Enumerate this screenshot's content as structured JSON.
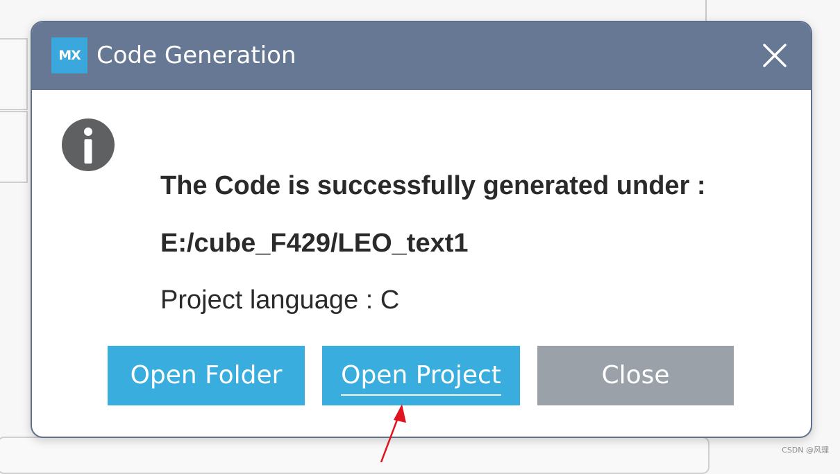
{
  "dialog": {
    "title": "Code Generation",
    "logo_text": "MX",
    "message_line_1": "The Code is successfully generated under :",
    "message_line_2": "E:/cube_F429/LEO_text1",
    "message_line_3": "Project language : C"
  },
  "buttons": {
    "open_folder": "Open Folder",
    "open_project": "Open Project",
    "close": "Close"
  },
  "icons": {
    "logo": "stm32cubemx-logo",
    "info": "info-icon",
    "close": "close-icon"
  },
  "colors": {
    "titlebar": "#667894",
    "primary_button": "#3aaddf",
    "secondary_button": "#9aa1a9",
    "annotation_arrow": "#e0141e"
  },
  "watermark": "CSDN @风理"
}
